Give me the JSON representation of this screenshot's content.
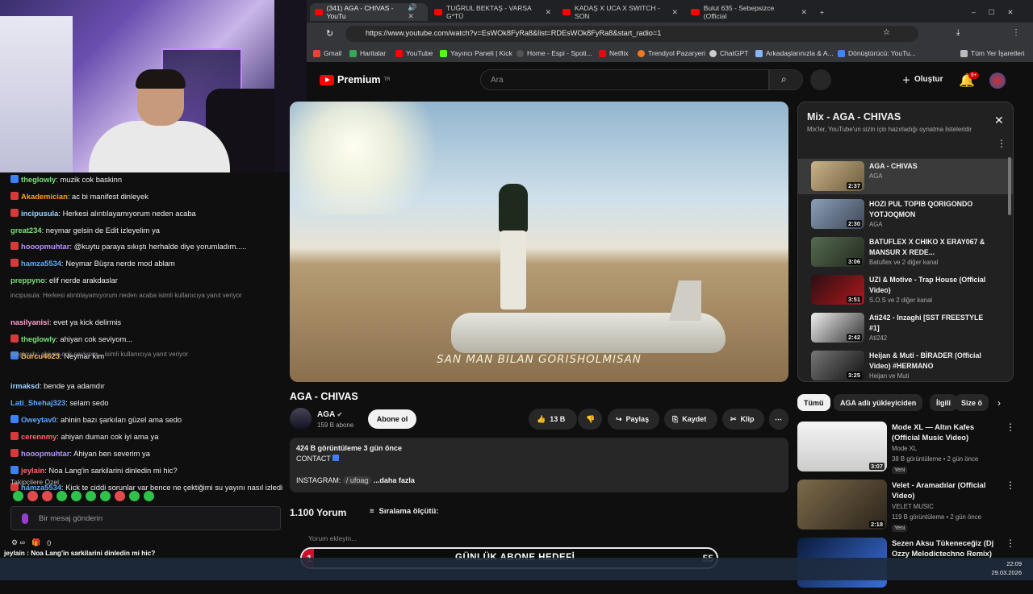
{
  "browser": {
    "tabs": [
      {
        "label": "(341) AGA - CHIVAS - YouTu",
        "active": true
      },
      {
        "label": "TUĞRUL BEKTAŞ - VARSA G*TÜ",
        "active": false
      },
      {
        "label": "KADAŞ X UCA X SWITCH - SON",
        "active": false
      },
      {
        "label": "Bulut 635 - Sebepsizce (Official",
        "active": false
      }
    ],
    "url": "https://www.youtube.com/watch?v=EsWOk8FyRa8&list=RDEsWOk8FyRa8&start_radio=1",
    "bookmarks": [
      "Gmail",
      "Haritalar",
      "YouTube",
      "Yayıncı Paneli | Kick",
      "Home - Espi - Spoti...",
      "Netflix",
      "Trendyol Pazaryeri",
      "ChatGPT",
      "Arkadaşlarınızla & A...",
      "Dönüştürücü: YouTu...",
      "Tüm Yer İşaretleri"
    ]
  },
  "yt": {
    "logo": "Premium",
    "logo_tr": "TR",
    "search_placeholder": "Ara",
    "create": "Oluştur",
    "notif": "9+",
    "video": {
      "subtitle": "SAN MAN BILAN GORISHOLMISAN",
      "title": "AGA - CHIVAS",
      "channel": "AGA",
      "subs": "159 B abone",
      "subscribe": "Abone ol",
      "likes": "13 B",
      "share": "Paylaş",
      "save": "Kaydet",
      "clip": "Klip",
      "desc_stats": "424 B görüntüleme  3 gün önce",
      "desc_contact": "CONTACT",
      "desc_instagram": "INSTAGRAM:",
      "desc_handle": "/ ufoag",
      "desc_more": "...daha fazla"
    },
    "comments": {
      "count": "1.100 Yorum",
      "sort": "Sıralama ölçütü:",
      "placeholder": "Yorum ekleyin..."
    },
    "playlist": {
      "title": "Mix - AGA - CHIVAS",
      "subtitle": "Mix'ler, YouTube'un sizin için hazırladığı oynatma listeleridir",
      "items": [
        {
          "title": "AGA - CHIVAS",
          "channel": "AGA",
          "duration": "2:37"
        },
        {
          "title": "HOZI PUL TOPIB QORIGONDO YOTJOQMON",
          "channel": "AGA",
          "duration": "2:30"
        },
        {
          "title": "BATUFLEX X CHIKO X ERAY067 & MANSUR X REDE...",
          "channel": "Batuflex ve 2 diğer kanal",
          "duration": "3:06"
        },
        {
          "title": "UZI & Motive - Trap House (Official Video)",
          "channel": "S.O.S ve 2 diğer kanal",
          "duration": "3:51"
        },
        {
          "title": "Ati242 - Inzaghi [SST FREESTYLE #1]",
          "channel": "Ati242",
          "duration": "2:42"
        },
        {
          "title": "Heijan & Muti - BİRADER (Official Video) #HERMANO",
          "channel": "Heijan ve Muti",
          "duration": "3:25"
        }
      ]
    },
    "chips": [
      "Tümü",
      "AGA adlı yükleyiciden",
      "İlgili",
      "Size ö"
    ],
    "recommendations": [
      {
        "title": "Mode XL — Altın Kafes (Official Music Video)",
        "channel": "Mode XL",
        "meta": "38 B görüntüleme • 2 gün önce",
        "badge": "Yeni",
        "duration": "3:07"
      },
      {
        "title": "Velet - Aramadılar  (Official Video)",
        "channel": "VELET MUSIC",
        "meta": "119 B görüntüleme • 2 gün önce",
        "badge": "Yeni",
        "duration": "2:18"
      },
      {
        "title": "Sezen Aksu Tükeneceğiz (Dj Ozzy Melodictechno Remix)",
        "channel": "",
        "meta": "",
        "badge": "",
        "duration": ""
      }
    ]
  },
  "chat": {
    "messages": [
      {
        "user": "theglowly",
        "text": ": muzik cok baskinn",
        "color": "#7ee07a"
      },
      {
        "user": "Akademician",
        "text": ": ac bi manifest dinleyek",
        "color": "#ff9f1a"
      },
      {
        "user": "incipusula",
        "text": ": Herkesi alıntılayamıyorum neden acaba",
        "color": "#9bd3ff"
      },
      {
        "user": "great234",
        "text": ": neymar gelsin de Edit izleyelim ya",
        "color": "#7ee07a"
      },
      {
        "user": "hooopmuhtar",
        "text": ": @kuytu paraya sıkıştı herhalde diye yorumladım.....",
        "color": "#b693ff"
      },
      {
        "user": "hamza5534",
        "text": ": Neymar Büşra nerde mod ablam",
        "color": "#5fa8ff"
      },
      {
        "user": "preppyno",
        "text": ": elif nerde arakdaslar",
        "color": "#7ee07a"
      },
      {
        "user": "nasilyanisi",
        "text": ": evet ya kick delirmis",
        "color": "#ff9fcb"
      },
      {
        "user": "theglowly",
        "text": ": ahiyan cok seviyom...",
        "color": "#7ee07a"
      },
      {
        "user": "Burcu4623",
        "text": ": Neymar kim",
        "color": "#ffb84d"
      },
      {
        "user": "irmaksd",
        "text": ": bende ya adamdır",
        "color": "#9bd3ff"
      },
      {
        "user": "Lati_Shehaj323",
        "text": ": selam sedo",
        "color": "#5fa8ff"
      },
      {
        "user": "Oweytav0",
        "text": ": ahinin bazı şarkıları güzel ama sedo",
        "color": "#5fa8ff"
      },
      {
        "user": "cerennmy",
        "text": ": ahiyan duman cok iyi ama ya",
        "color": "#ff6b6b"
      },
      {
        "user": "hooopmuhtar",
        "text": ": Ahiyan ben severim ya",
        "color": "#b693ff"
      },
      {
        "user": "jeylain",
        "text": ": Noa Lang'in sarkilarini dinledin mi hic?",
        "color": "#ff6b6b"
      },
      {
        "user": "hamza5534",
        "text": ": Kick te ciddi sorunlar var bence ne çektiğimi su yayını nasıl izledi",
        "color": "#5fa8ff"
      }
    ],
    "reply1": "incipusula: Herkesi alıntılayamıyorum neden acaba isimli kullanıcıya yanıt veriyor",
    "reply2": "theglowly: ahiyan cok seviyom... isimli kullanıcıya yanıt veriyor",
    "followers_label": "Takipçilere Özel",
    "input_placeholder": "Bir mesaj gönderin",
    "count": "0"
  },
  "goal": {
    "label": "GÜNLÜK ABONE HEDEFİ",
    "current": 1,
    "target": 55
  },
  "overlay_msg": "jeylain : Noa Lang'in sarkilarini dinledin mi hic?",
  "clock": {
    "time": "22:09",
    "date": "29.03.2026"
  }
}
